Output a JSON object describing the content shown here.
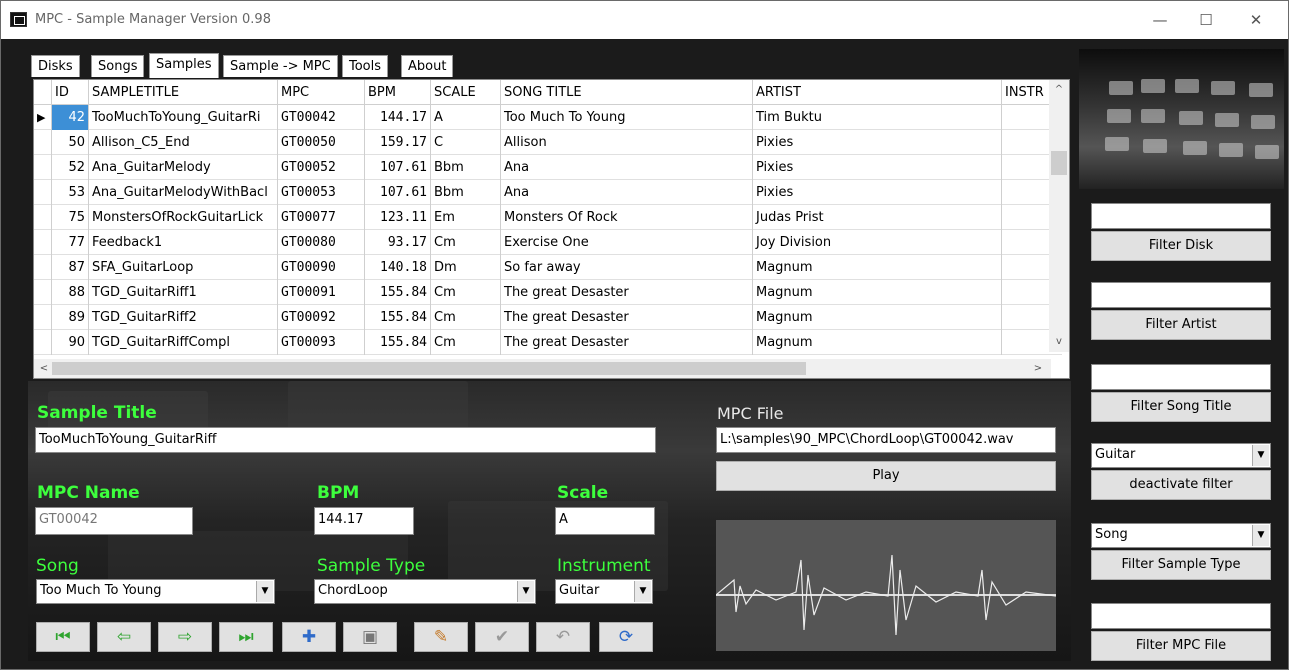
{
  "window": {
    "title": "MPC - Sample Manager Version 0.98",
    "min": "—",
    "max": "☐",
    "close": "✕"
  },
  "tabs": [
    "Disks",
    "Songs",
    "Samples",
    "Sample -> MPC",
    "Tools",
    "About"
  ],
  "active_tab": "Samples",
  "grid": {
    "columns": [
      "ID",
      "SAMPLETITLE",
      "MPC",
      "BPM",
      "SCALE",
      "SONG TITLE",
      "ARTIST",
      "INSTR"
    ],
    "rows": [
      [
        "42",
        "TooMuchToYoung_GuitarRi",
        "GT00042",
        "144.17",
        "A",
        "Too Much To Young",
        "Tim Buktu"
      ],
      [
        "50",
        "Allison_C5_End",
        "GT00050",
        "159.17",
        "C",
        "Allison",
        "Pixies"
      ],
      [
        "52",
        "Ana_GuitarMelody",
        "GT00052",
        "107.61",
        "Bbm",
        "Ana",
        "Pixies"
      ],
      [
        "53",
        "Ana_GuitarMelodyWithBacl",
        "GT00053",
        "107.61",
        "Bbm",
        "Ana",
        "Pixies"
      ],
      [
        "75",
        "MonstersOfRockGuitarLick",
        "GT00077",
        "123.11",
        "Em",
        "Monsters Of Rock",
        "Judas Prist"
      ],
      [
        "77",
        "Feedback1",
        "GT00080",
        "93.17",
        "Cm",
        "Exercise One",
        "Joy Division"
      ],
      [
        "87",
        "SFA_GuitarLoop",
        "GT00090",
        "140.18",
        "Dm",
        "So far away",
        "Magnum"
      ],
      [
        "88",
        "TGD_GuitarRiff1",
        "GT00091",
        "155.84",
        "Cm",
        "The great Desaster",
        "Magnum"
      ],
      [
        "89",
        "TGD_GuitarRiff2",
        "GT00092",
        "155.84",
        "Cm",
        "The great Desaster",
        "Magnum"
      ],
      [
        "90",
        "TGD_GuitarRiffCompl",
        "GT00093",
        "155.84",
        "Cm",
        "The great Desaster",
        "Magnum"
      ]
    ]
  },
  "detail": {
    "sample_title_label": "Sample Title",
    "sample_title": "TooMuchToYoung_GuitarRiff",
    "mpc_file_label": "MPC File",
    "mpc_file": "L:\\samples\\90_MPC\\ChordLoop\\GT00042.wav",
    "play": "Play",
    "mpc_name_label": "MPC Name",
    "mpc_name": "GT00042",
    "bpm_label": "BPM",
    "bpm": "144.17",
    "scale_label": "Scale",
    "scale": "A",
    "song_label": "Song",
    "song": "Too Much To Young",
    "sample_type_label": "Sample Type",
    "sample_type": "ChordLoop",
    "instrument_label": "Instrument",
    "instrument": "Guitar"
  },
  "toolbar": [
    "first-record-icon",
    "prev-record-icon",
    "next-record-icon",
    "last-record-icon",
    "add-record-icon",
    "delete-record-icon",
    "edit-record-icon",
    "post-record-icon",
    "cancel-edit-icon",
    "refresh-icon"
  ],
  "filters": {
    "disk_btn": "Filter Disk",
    "artist_btn": "Filter Artist",
    "song_title_btn": "Filter Song Title",
    "instrument_value": "Guitar",
    "deactivate": "deactivate filter",
    "type_value": "Song",
    "sample_type_btn": "Filter Sample Type",
    "mpc_file_btn": "Filter MPC File"
  }
}
